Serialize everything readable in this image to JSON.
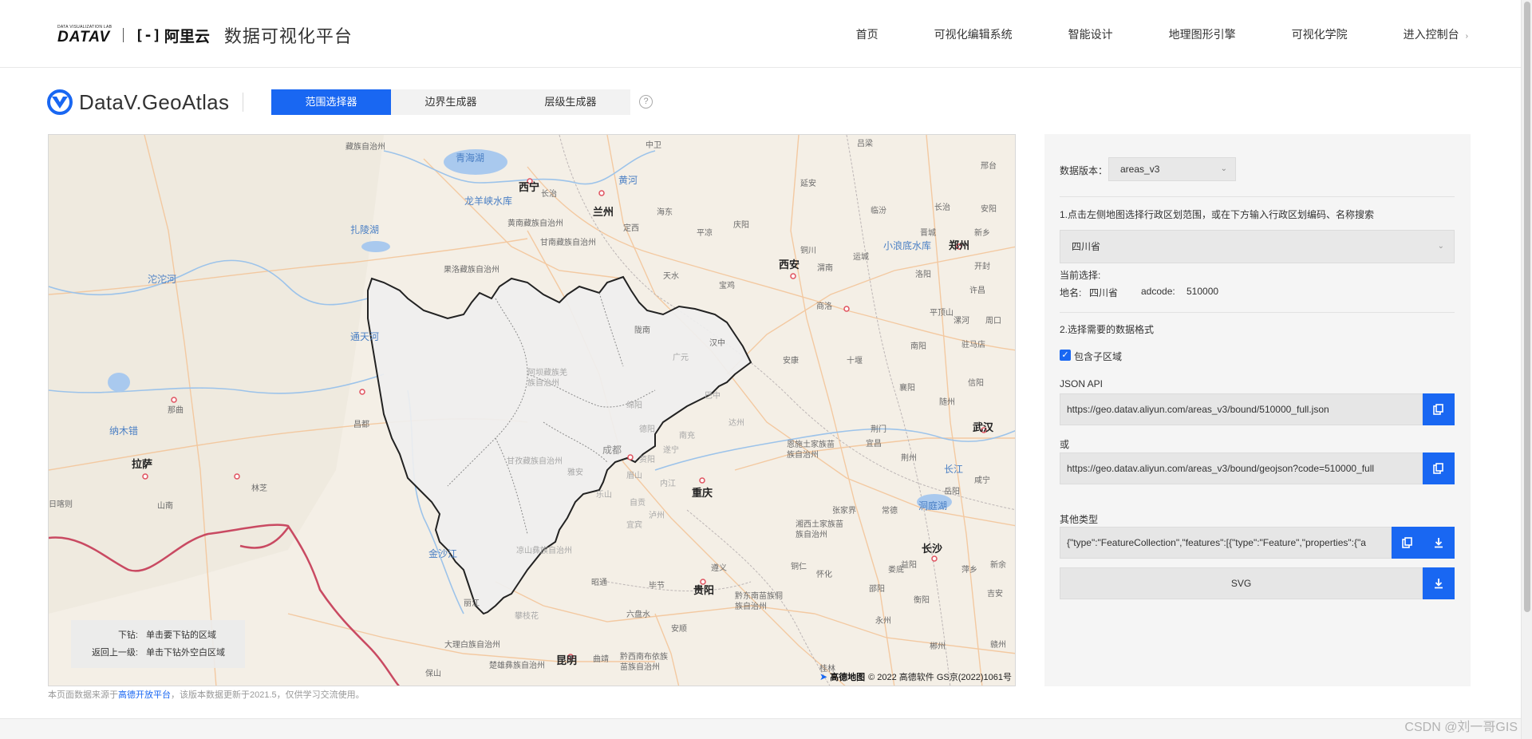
{
  "header": {
    "datav_small": "DATA VISUALIZATION LAB",
    "datav_logo": "DATAV",
    "aliyun_logo": "阿里云",
    "platform_title": "数据可视化平台",
    "nav": [
      {
        "label": "首页"
      },
      {
        "label": "可视化编辑系统"
      },
      {
        "label": "智能设计"
      },
      {
        "label": "地理图形引擎"
      },
      {
        "label": "可视化学院"
      },
      {
        "label": "进入控制台",
        "chevron": "›"
      }
    ]
  },
  "tool": {
    "brand": "DataV.GeoAtlas",
    "tabs": [
      {
        "label": "范围选择器",
        "active": true
      },
      {
        "label": "边界生成器",
        "active": false
      },
      {
        "label": "层级生成器",
        "active": false
      }
    ],
    "help": "?"
  },
  "map": {
    "labels": {
      "cities": [
        "西宁",
        "兰州",
        "西安",
        "郑州",
        "武汉",
        "重庆",
        "成都",
        "贵阳",
        "昆明",
        "长沙",
        "拉萨"
      ],
      "water": [
        "青海湖",
        "黄河",
        "龙羊峡水库",
        "扎陵湖",
        "沱沱河",
        "通天河",
        "小浪底水库",
        "纳木错",
        "长江",
        "洞庭湖",
        "金沙江"
      ],
      "regions": [
        "藏族自治州",
        "中卫",
        "吕梁",
        "邢台",
        "延安",
        "临汾",
        "长治",
        "安阳",
        "海东",
        "固原",
        "庆阳",
        "晋城",
        "新乡",
        "定西",
        "平凉",
        "铜川",
        "运城",
        "开封",
        "甘南藏族自治州",
        "黄南藏族自治州",
        "天水",
        "宝鸡",
        "渭南",
        "洛阳",
        "许昌",
        "果洛藏族自治州",
        "商洛",
        "平顶山",
        "漯河",
        "周口",
        "陇南",
        "汉中",
        "南阳",
        "驻马店",
        "安康",
        "十堰",
        "襄阳",
        "那曲",
        "信阳",
        "随州",
        "昌都",
        "荆门",
        "恩施土家族苗族自治州",
        "宜昌",
        "荆州",
        "日喀则",
        "山南",
        "林芝",
        "岳阳",
        "咸宁",
        "张家界",
        "常德",
        "湘西土家族苗族自治州",
        "遵义",
        "益阳",
        "铜仁",
        "怀化",
        "娄底",
        "萍乡",
        "新余",
        "昭通",
        "毕节",
        "邵阳",
        "衡阳",
        "吉安",
        "丽江",
        "六盘水",
        "黔东南苗族侗族自治州",
        "安顺",
        "永州",
        "大理白族自治州",
        "曲靖",
        "黔西南布依族苗族自治州",
        "郴州",
        "赣州",
        "保山",
        "楚雄彝族自治州",
        "桂林"
      ],
      "inside": [
        "阿坝藏族羌族自治州",
        "广元",
        "巴中",
        "达州",
        "南充",
        "绵阳",
        "德阳",
        "甘孜藏族自治州",
        "成都",
        "资阳",
        "遂宁",
        "雅安",
        "眉山",
        "乐山",
        "内江",
        "自贡",
        "泸州",
        "宜宾",
        "凉山彝族自治州",
        "攀枝花"
      ]
    },
    "hint": {
      "drill_key": "下钻:",
      "drill_value": "单击要下钻的区域",
      "back_key": "返回上一级:",
      "back_value": "单击下钻外空白区域"
    },
    "attribution": {
      "amap": "高德地图",
      "text": "© 2022 高德软件 GS京(2022)1061号"
    }
  },
  "source_note": {
    "prefix": "本页面数据来源于",
    "link": "高德开放平台",
    "suffix": "，该版本数据更新于2021.5，仅供学习交流使用。"
  },
  "panel": {
    "version_label": "数据版本：",
    "version_value": "areas_v3",
    "step1": "1.点击左侧地图选择行政区划范围，或在下方输入行政区划编码、名称搜索",
    "region_value": "四川省",
    "current_label": "当前选择:",
    "name_label": "地名:",
    "name_value": "四川省",
    "adcode_label": "adcode:",
    "adcode_value": "510000",
    "step2": "2.选择需要的数据格式",
    "include_sub_label": "包含子区域",
    "include_sub_checked": true,
    "json_api_label": "JSON API",
    "json_api_url": "https://geo.datav.aliyun.com/areas_v3/bound/510000_full.json",
    "or_label": "或",
    "geojson_url": "https://geo.datav.aliyun.com/areas_v3/bound/geojson?code=510000_full",
    "other_types_label": "其他类型",
    "geojson_text": "{\"type\":\"FeatureCollection\",\"features\":[{\"type\":\"Feature\",\"properties\":{\"a",
    "svg_label": "SVG"
  },
  "watermark": "CSDN @刘一哥GIS",
  "colors": {
    "accent": "#1967f2",
    "map_background": "#f4efe6",
    "province_fill": "#efefef",
    "boundary": "#c94a62"
  }
}
